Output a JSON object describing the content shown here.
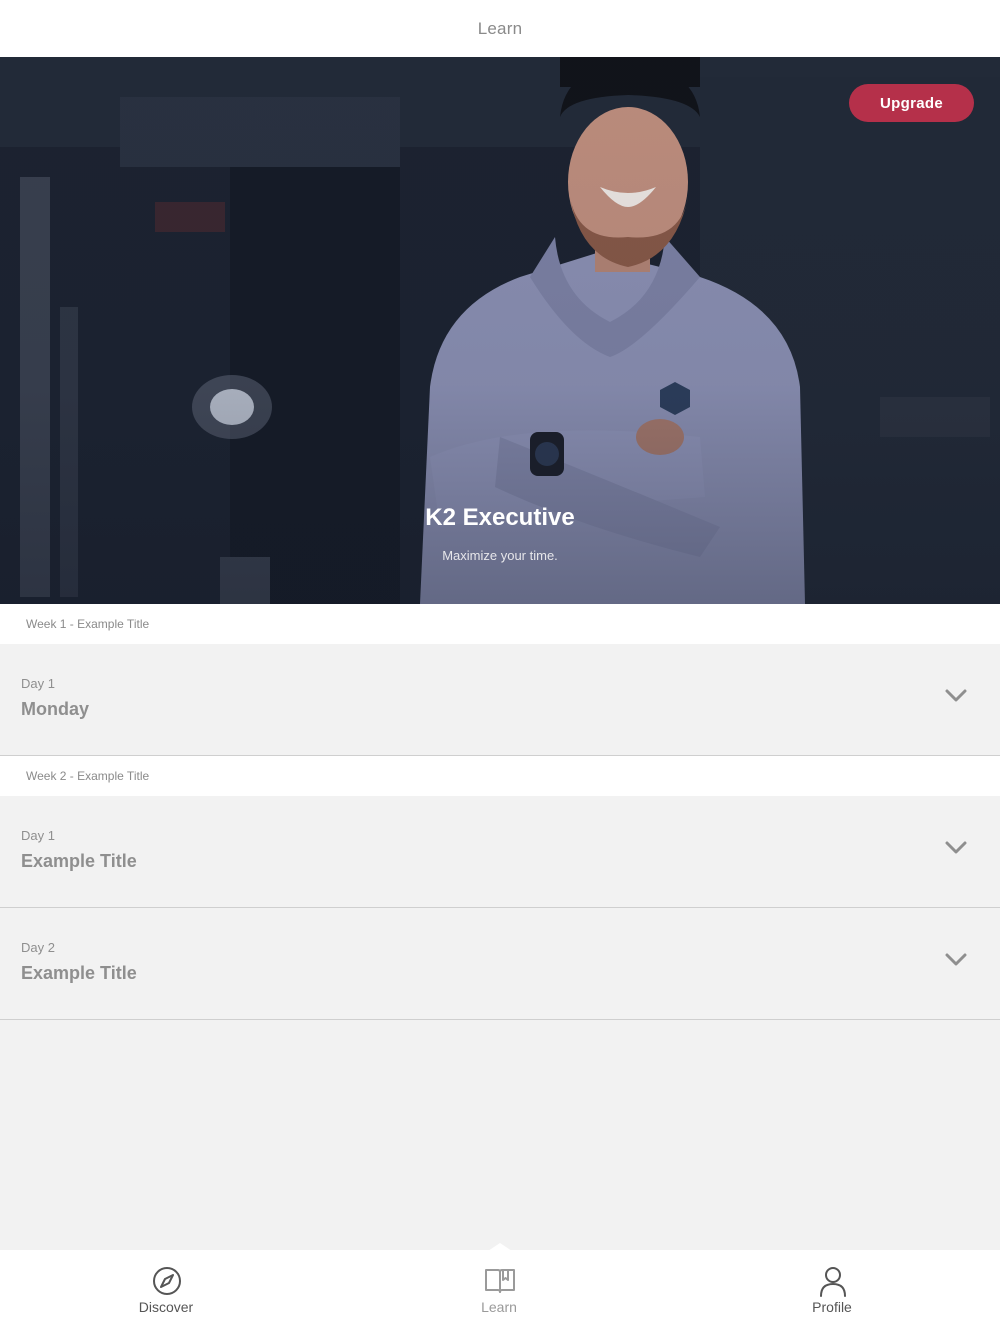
{
  "header": {
    "title": "Learn"
  },
  "hero": {
    "title": "K2 Executive",
    "subtitle": "Maximize your time.",
    "upgrade_label": "Upgrade"
  },
  "weeks": [
    {
      "title": "Week 1 - Example Title",
      "days": [
        {
          "day": "Day 1",
          "title": "Monday"
        }
      ]
    },
    {
      "title": "Week 2 - Example Title",
      "days": [
        {
          "day": "Day 1",
          "title": "Example Title"
        },
        {
          "day": "Day 2",
          "title": "Example Title"
        }
      ]
    }
  ],
  "tabs": [
    {
      "label": "Discover",
      "icon": "compass-icon",
      "active": false
    },
    {
      "label": "Learn",
      "icon": "book-icon",
      "active": true
    },
    {
      "label": "Profile",
      "icon": "person-icon",
      "active": false
    }
  ],
  "colors": {
    "accent": "#b5304a",
    "text_muted": "#8f8f8f",
    "background": "#f2f2f2"
  }
}
